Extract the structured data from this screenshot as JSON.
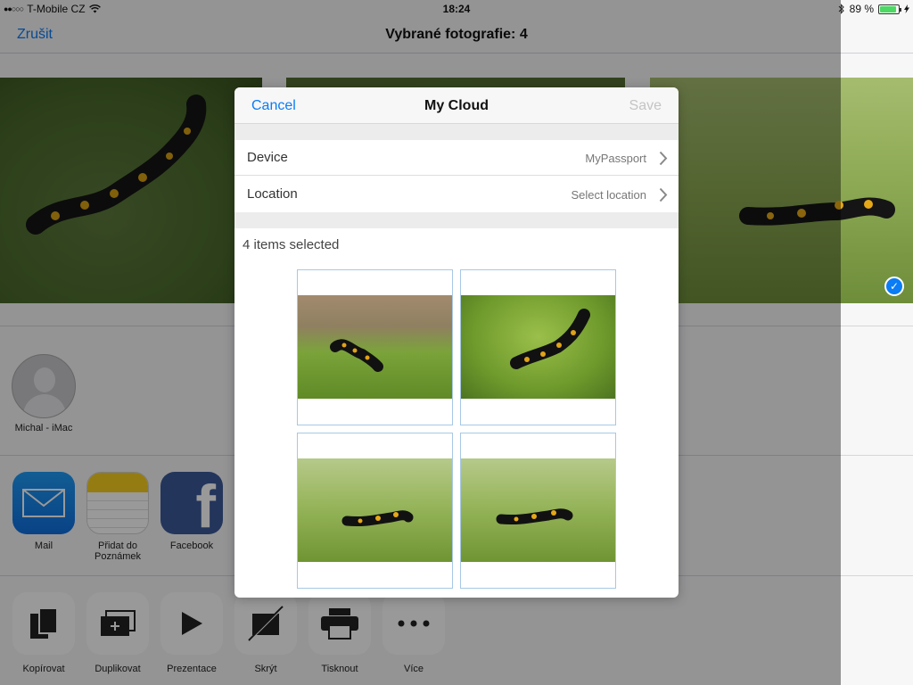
{
  "status_bar": {
    "carrier": "T-Mobile CZ",
    "time": "18:24",
    "battery": "89 %",
    "battery_level": 0.89
  },
  "share_sheet": {
    "cancel_label": "Zrušit",
    "title": "Vybrané fotografie: 4",
    "airdrop_contacts": [
      {
        "name": "Michal - iMac"
      }
    ],
    "apps": [
      {
        "label": "Mail",
        "icon": "mail-icon"
      },
      {
        "label": "Přidat do Poznámek",
        "icon": "notes-icon"
      },
      {
        "label": "Facebook",
        "icon": "facebook-icon"
      }
    ],
    "actions": [
      {
        "label": "Kopírovat",
        "icon": "copy-icon"
      },
      {
        "label": "Duplikovat",
        "icon": "duplicate-icon"
      },
      {
        "label": "Prezentace",
        "icon": "play-icon"
      },
      {
        "label": "Skrýt",
        "icon": "hide-icon"
      },
      {
        "label": "Tisknout",
        "icon": "printer-icon"
      },
      {
        "label": "Více",
        "icon": "more-icon"
      }
    ]
  },
  "modal": {
    "cancel_label": "Cancel",
    "title": "My Cloud",
    "save_label": "Save",
    "rows": [
      {
        "label": "Device",
        "value": "MyPassport"
      },
      {
        "label": "Location",
        "value": "Select location"
      }
    ],
    "selection_text": "4 items selected",
    "thumbnails": [
      "salamander-photo",
      "salamander-photo",
      "salamander-photo",
      "salamander-photo"
    ]
  },
  "colors": {
    "accent": "#0a7cf5",
    "disabled": "#c4c4c4",
    "thumbnail_border": "#a7c8e4"
  }
}
